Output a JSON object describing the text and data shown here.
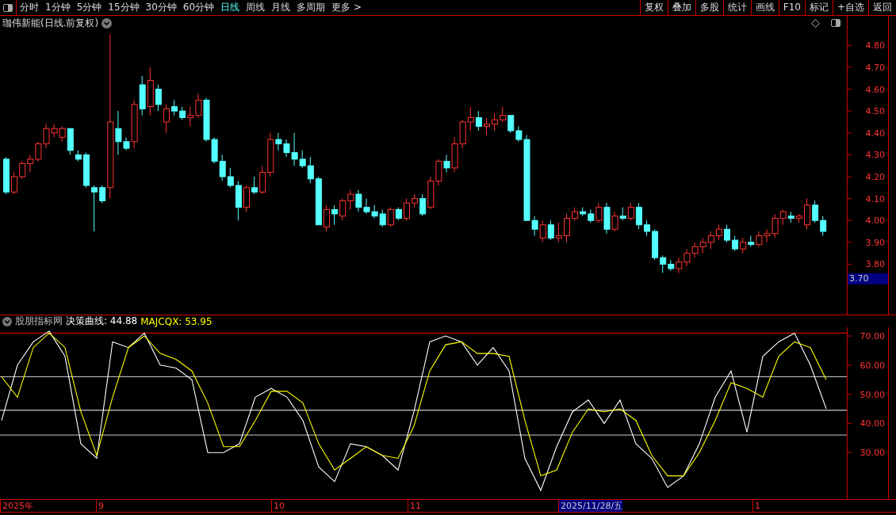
{
  "toolbar": {
    "periods": [
      {
        "label": "分时",
        "selected": false
      },
      {
        "label": "1分钟",
        "selected": false
      },
      {
        "label": "5分钟",
        "selected": false
      },
      {
        "label": "15分钟",
        "selected": false
      },
      {
        "label": "30分钟",
        "selected": false
      },
      {
        "label": "60分钟",
        "selected": false
      },
      {
        "label": "日线",
        "selected": true
      },
      {
        "label": "周线",
        "selected": false
      },
      {
        "label": "月线",
        "selected": false
      },
      {
        "label": "多周期",
        "selected": false
      }
    ],
    "more": "更多 >",
    "actions": [
      "复权",
      "叠加",
      "多股",
      "统计",
      "画线",
      "F10",
      "标记",
      "+自选",
      "返回"
    ]
  },
  "main_chart": {
    "title": "珈伟新能(日线.前复权)",
    "cursor_price": "3.70",
    "chart_data": {
      "type": "candlestick",
      "ohlc": [
        [
          4.28,
          4.29,
          4.12,
          4.13
        ],
        [
          4.13,
          4.22,
          4.12,
          4.2
        ],
        [
          4.2,
          4.27,
          4.19,
          4.26
        ],
        [
          4.26,
          4.3,
          4.22,
          4.28
        ],
        [
          4.28,
          4.36,
          4.27,
          4.35
        ],
        [
          4.35,
          4.44,
          4.33,
          4.42
        ],
        [
          4.4,
          4.44,
          4.38,
          4.42
        ],
        [
          4.38,
          4.43,
          4.36,
          4.42
        ],
        [
          4.42,
          4.42,
          4.3,
          4.32
        ],
        [
          4.3,
          4.32,
          4.27,
          4.28
        ],
        [
          4.3,
          4.31,
          4.15,
          4.16
        ],
        [
          4.15,
          4.16,
          3.95,
          4.13
        ],
        [
          4.15,
          4.16,
          4.08,
          4.09
        ],
        [
          4.15,
          4.85,
          4.1,
          4.45
        ],
        [
          4.42,
          4.5,
          4.3,
          4.36
        ],
        [
          4.36,
          4.38,
          4.32,
          4.33
        ],
        [
          4.36,
          4.55,
          4.33,
          4.53
        ],
        [
          4.62,
          4.66,
          4.48,
          4.51
        ],
        [
          4.52,
          4.7,
          4.48,
          4.64
        ],
        [
          4.6,
          4.62,
          4.5,
          4.53
        ],
        [
          4.45,
          4.53,
          4.4,
          4.51
        ],
        [
          4.52,
          4.55,
          4.48,
          4.5
        ],
        [
          4.5,
          4.52,
          4.46,
          4.47
        ],
        [
          4.47,
          4.52,
          4.43,
          4.48
        ],
        [
          4.48,
          4.58,
          4.47,
          4.55
        ],
        [
          4.55,
          4.56,
          4.36,
          4.37
        ],
        [
          4.37,
          4.38,
          4.26,
          4.27
        ],
        [
          4.27,
          4.3,
          4.18,
          4.2
        ],
        [
          4.2,
          4.24,
          4.15,
          4.16
        ],
        [
          4.16,
          4.18,
          4.0,
          4.06
        ],
        [
          4.06,
          4.16,
          4.04,
          4.15
        ],
        [
          4.15,
          4.2,
          4.12,
          4.13
        ],
        [
          4.13,
          4.25,
          4.12,
          4.22
        ],
        [
          4.22,
          4.4,
          4.2,
          4.37
        ],
        [
          4.37,
          4.4,
          4.32,
          4.35
        ],
        [
          4.35,
          4.37,
          4.29,
          4.31
        ],
        [
          4.31,
          4.4,
          4.25,
          4.28
        ],
        [
          4.28,
          4.32,
          4.24,
          4.25
        ],
        [
          4.25,
          4.29,
          4.17,
          4.19
        ],
        [
          4.19,
          4.2,
          3.98,
          3.98
        ],
        [
          3.97,
          4.07,
          3.95,
          4.05
        ],
        [
          4.05,
          4.07,
          3.98,
          4.03
        ],
        [
          4.02,
          4.1,
          4.0,
          4.09
        ],
        [
          4.09,
          4.14,
          4.05,
          4.12
        ],
        [
          4.12,
          4.14,
          4.04,
          4.06
        ],
        [
          4.06,
          4.1,
          4.03,
          4.04
        ],
        [
          4.04,
          4.07,
          4.01,
          4.02
        ],
        [
          4.03,
          4.05,
          3.97,
          3.98
        ],
        [
          3.98,
          4.06,
          3.97,
          4.05
        ],
        [
          4.05,
          4.06,
          4.0,
          4.01
        ],
        [
          4.01,
          4.1,
          4.0,
          4.08
        ],
        [
          4.08,
          4.12,
          4.06,
          4.1
        ],
        [
          4.1,
          4.12,
          4.02,
          4.03
        ],
        [
          4.06,
          4.2,
          4.05,
          4.18
        ],
        [
          4.18,
          4.28,
          4.16,
          4.27
        ],
        [
          4.27,
          4.3,
          4.22,
          4.24
        ],
        [
          4.24,
          4.38,
          4.22,
          4.35
        ],
        [
          4.35,
          4.46,
          4.33,
          4.45
        ],
        [
          4.45,
          4.52,
          4.41,
          4.47
        ],
        [
          4.47,
          4.5,
          4.41,
          4.43
        ],
        [
          4.43,
          4.47,
          4.39,
          4.44
        ],
        [
          4.44,
          4.49,
          4.41,
          4.46
        ],
        [
          4.46,
          4.52,
          4.45,
          4.48
        ],
        [
          4.48,
          4.48,
          4.4,
          4.41
        ],
        [
          4.41,
          4.43,
          4.36,
          4.37
        ],
        [
          4.37,
          4.39,
          4.0,
          4.0
        ],
        [
          4.0,
          4.02,
          3.93,
          3.96
        ],
        [
          3.92,
          4.0,
          3.9,
          3.98
        ],
        [
          3.98,
          4.0,
          3.91,
          3.92
        ],
        [
          3.92,
          3.99,
          3.9,
          3.93
        ],
        [
          3.93,
          4.03,
          3.9,
          4.01
        ],
        [
          4.01,
          4.06,
          4.0,
          4.04
        ],
        [
          4.04,
          4.06,
          4.02,
          4.03
        ],
        [
          4.03,
          4.05,
          3.99,
          4.0
        ],
        [
          4.0,
          4.08,
          3.99,
          4.06
        ],
        [
          4.06,
          4.08,
          3.94,
          3.96
        ],
        [
          3.96,
          4.04,
          3.95,
          4.02
        ],
        [
          4.02,
          4.06,
          4.0,
          4.01
        ],
        [
          4.01,
          4.08,
          4.0,
          4.06
        ],
        [
          4.06,
          4.08,
          3.96,
          3.98
        ],
        [
          3.98,
          4.0,
          3.93,
          3.95
        ],
        [
          3.95,
          3.96,
          3.82,
          3.83
        ],
        [
          3.83,
          3.84,
          3.76,
          3.8
        ],
        [
          3.8,
          3.82,
          3.77,
          3.78
        ],
        [
          3.78,
          3.83,
          3.76,
          3.81
        ],
        [
          3.81,
          3.87,
          3.79,
          3.85
        ],
        [
          3.85,
          3.9,
          3.83,
          3.88
        ],
        [
          3.88,
          3.92,
          3.85,
          3.9
        ],
        [
          3.9,
          3.95,
          3.87,
          3.93
        ],
        [
          3.93,
          3.98,
          3.91,
          3.96
        ],
        [
          3.96,
          3.98,
          3.9,
          3.91
        ],
        [
          3.91,
          3.93,
          3.86,
          3.87
        ],
        [
          3.87,
          3.92,
          3.85,
          3.9
        ],
        [
          3.9,
          3.93,
          3.88,
          3.89
        ],
        [
          3.89,
          3.95,
          3.88,
          3.93
        ],
        [
          3.93,
          3.96,
          3.9,
          3.94
        ],
        [
          3.94,
          4.03,
          3.92,
          4.01
        ],
        [
          4.01,
          4.05,
          3.98,
          4.04
        ],
        [
          4.02,
          4.04,
          3.99,
          4.01
        ],
        [
          4.01,
          4.03,
          3.99,
          4.02
        ],
        [
          3.98,
          4.1,
          3.96,
          4.07
        ],
        [
          4.07,
          4.09,
          3.99,
          4.0
        ],
        [
          4.0,
          4.02,
          3.93,
          3.95
        ]
      ],
      "ylim": [
        3.57,
        4.935
      ],
      "yticks": [
        {
          "value": 4.8,
          "label": "4.80"
        },
        {
          "value": 4.7,
          "label": "4.70"
        },
        {
          "value": 4.6,
          "label": "4.60"
        },
        {
          "value": 4.5,
          "label": "4.50"
        },
        {
          "value": 4.4,
          "label": "4.40"
        },
        {
          "value": 4.3,
          "label": "4.30"
        },
        {
          "value": 4.2,
          "label": "4.20"
        },
        {
          "value": 4.1,
          "label": "4.10"
        },
        {
          "value": 4.0,
          "label": "4.00"
        },
        {
          "value": 3.9,
          "label": "3.90"
        },
        {
          "value": 3.8,
          "label": "3.80"
        }
      ]
    }
  },
  "indicator": {
    "name": "股朋指标网",
    "readings": [
      ": 44.88",
      ": 53.95"
    ],
    "chart_data": {
      "type": "line",
      "series": [
        {
          "name": "决策曲线",
          "color": "#ffffff",
          "values": [
            41,
            60,
            68,
            71.6,
            63,
            33,
            28,
            68,
            66,
            71,
            60,
            59,
            55,
            30,
            30,
            33,
            49,
            52,
            49,
            41,
            25,
            20,
            33,
            32,
            29,
            24,
            44,
            68,
            70,
            68,
            60,
            66,
            58,
            28,
            17,
            32,
            44,
            48,
            40,
            48,
            33,
            28,
            18,
            22,
            33,
            49,
            58,
            37,
            63,
            68,
            71,
            60,
            45
          ]
        },
        {
          "name": "MAJCQX",
          "color": "#ffff00",
          "values": [
            56,
            49,
            66,
            71,
            66,
            44,
            29,
            49,
            66,
            70,
            64,
            62,
            58,
            47,
            32,
            32,
            41,
            51,
            51,
            47,
            33,
            24,
            28,
            32,
            29,
            28,
            39,
            58,
            67,
            68,
            64,
            64,
            63,
            41,
            22,
            24,
            37,
            45,
            44,
            45,
            41,
            29,
            22,
            22,
            30,
            41,
            54,
            52,
            49,
            63,
            68,
            66,
            55
          ]
        }
      ],
      "ylim": [
        14,
        73
      ],
      "yticks": [
        {
          "value": 70,
          "label": "70.00"
        },
        {
          "value": 60,
          "label": "60.00"
        },
        {
          "value": 50,
          "label": "50.00"
        },
        {
          "value": 40,
          "label": "40.00"
        },
        {
          "value": 30,
          "label": "30.00"
        }
      ],
      "ref_lines": [
        {
          "axis": "y",
          "value": 71,
          "color": "#ff0000"
        },
        {
          "axis": "y",
          "value": 56,
          "color": "#c8c8c8"
        },
        {
          "axis": "y",
          "value": 44.5,
          "color": "#ffffff"
        },
        {
          "axis": "y",
          "value": 36,
          "color": "#c8c8c8"
        }
      ]
    }
  },
  "time_axis": [
    {
      "label": "2025年",
      "cursor": false
    },
    {
      "label": "9",
      "cursor": false
    },
    {
      "label": "10",
      "cursor": false
    },
    {
      "label": "11",
      "cursor": false
    },
    {
      "label": "2025/11/28/五",
      "cursor": true
    },
    {
      "label": "1",
      "cursor": false
    }
  ]
}
